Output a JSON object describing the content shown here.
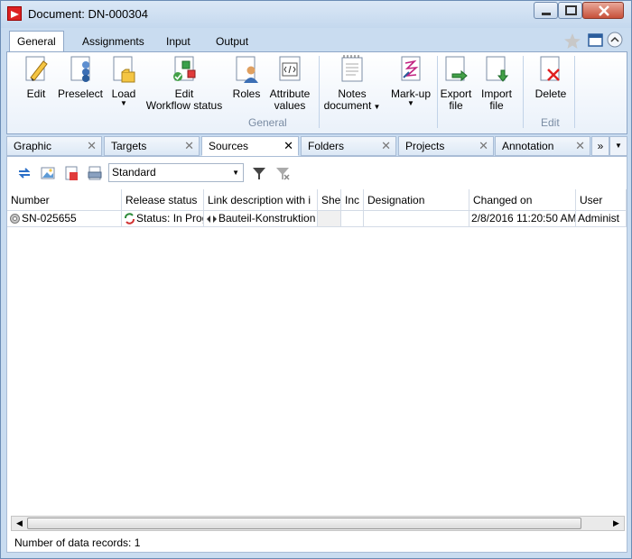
{
  "window": {
    "title": "Document: DN-000304"
  },
  "ribbon": {
    "tabs": [
      "General",
      "Assignments",
      "Input",
      "Output"
    ],
    "buttons": {
      "edit": "Edit",
      "preselect": "Preselect",
      "load": "Load",
      "edit_workflow_1": "Edit",
      "edit_workflow_2": "Workflow status",
      "roles": "Roles",
      "attribute_1": "Attribute",
      "attribute_2": "values",
      "notes_1": "Notes",
      "notes_2": "document",
      "markup": "Mark-up",
      "export_1": "Export",
      "export_2": "file",
      "import_1": "Import",
      "import_2": "file",
      "delete": "Delete"
    },
    "groups": {
      "general": "General",
      "edit": "Edit"
    }
  },
  "doc_tabs": [
    "Graphic",
    "Targets",
    "Sources",
    "Folders",
    "Projects",
    "Annotation"
  ],
  "doc_tabs_more": "»",
  "toolbar": {
    "view_select": "Standard"
  },
  "grid": {
    "columns": [
      "Number",
      "Release status",
      "Link description with i",
      "She",
      "Inc",
      "Designation",
      "Changed on",
      "User"
    ],
    "rows": [
      [
        "SN-025655",
        "Status: In Prog",
        "Bauteil-Konstruktion",
        "",
        "",
        "",
        "2/8/2016 11:20:50 AM",
        "Administ"
      ]
    ]
  },
  "status_bar": {
    "records": "Number of data records: 1"
  },
  "colors": {
    "accent": "#c9dcf0",
    "close_red": "#c7503a"
  }
}
